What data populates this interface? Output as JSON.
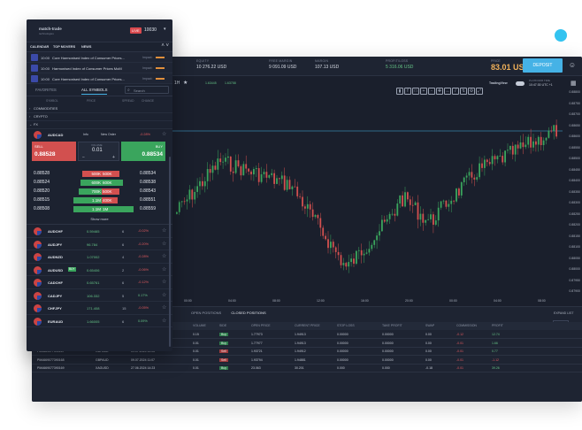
{
  "stats": [
    {
      "label": "EQUITY",
      "value": "10 276.22 USD"
    },
    {
      "label": "FREE MARGIN",
      "value": "9 091.09 USD"
    },
    {
      "label": "MARGIN",
      "value": "107.13 USD"
    },
    {
      "label": "PROFIT/LOSS",
      "value": "5 316.06 USD"
    }
  ],
  "price": {
    "label": "PRICE",
    "value": "83.01 USD"
  },
  "deposit_label": "DEPOSIT",
  "chart": {
    "timeframe": "1H",
    "bid_label": "1.63445",
    "ask_label": "1.63758",
    "logo_text": "TradingView",
    "platform_time_label": "PLATFORM TIME",
    "platform_time": "10:47:30 UTC +1",
    "price_ticks": [
      "0.88800",
      "0.88750",
      "0.88700",
      "0.88650",
      "0.88600",
      "0.88550",
      "0.88500",
      "0.88450",
      "0.88400",
      "0.88350",
      "0.88300",
      "0.88250",
      "0.88200",
      "0.88150",
      "0.88100",
      "0.88050",
      "0.88000",
      "0.87950",
      "0.87900"
    ],
    "time_ticks": [
      "00:00",
      "04:00",
      "08:00",
      "12:00",
      "16:00",
      "20:00",
      "00:00",
      "04:00",
      "08:00",
      "12:00",
      "16:00"
    ],
    "expand_label": "EXPAND LIST"
  },
  "positions": {
    "tabs": [
      "OPEN POSITIONS",
      "CLOSED POSITIONS"
    ],
    "reset_label": "RESET",
    "headers": [
      "ID",
      "SYMBOL",
      "OPEN TIME",
      "VOLUME",
      "SIDE",
      "OPEN PRICE",
      "CURRENT PRICE",
      "STOP LOSS",
      "TAKE PROFIT",
      "SWAP",
      "COMMISSION",
      "PROFIT"
    ],
    "rows": [
      {
        "id": "PM4669077390165",
        "symbol": "GBPAUD",
        "time": "09.07.2024 10:58",
        "volume": "0.15",
        "side": "Buy",
        "open": "1.77973",
        "current": "1.94913",
        "sl": "0.00000",
        "tp": "0.00000",
        "swap": "0.00",
        "comm": "-0.12",
        "profit": "12.74"
      },
      {
        "id": "PM4669077390166",
        "symbol": "GBPAUD",
        "time": "09.07.2024 11:02",
        "volume": "0.01",
        "side": "Buy",
        "open": "1.77977",
        "current": "1.94913",
        "sl": "0.00000",
        "tp": "0.00000",
        "swap": "0.00",
        "comm": "-0.01",
        "profit": "1.66"
      },
      {
        "id": "PM4669077390167",
        "symbol": "GBPAUD",
        "time": "09.07.2024 11:05",
        "volume": "0.01",
        "side": "Sell",
        "open": "1.93721",
        "current": "1.94912",
        "sl": "0.00000",
        "tp": "0.00000",
        "swap": "0.00",
        "comm": "-0.01",
        "profit": "0.77"
      },
      {
        "id": "PM4669077390168",
        "symbol": "GBPAUD",
        "time": "09.07.2024 11:07",
        "volume": "0.01",
        "side": "Sell",
        "open": "1.93794",
        "current": "1.94881",
        "sl": "0.00000",
        "tp": "0.00000",
        "swap": "0.00",
        "comm": "-0.01",
        "profit": "-1.12"
      },
      {
        "id": "PM4669077390169",
        "symbol": "XAGUSD",
        "time": "27.06.2024 14:23",
        "volume": "0.01",
        "side": "Buy",
        "open": "23.063",
        "current": "30.201",
        "sl": "0.000",
        "tp": "0.000",
        "swap": "-0.18",
        "comm": "-0.01",
        "profit": "39.26"
      }
    ]
  },
  "panel": {
    "logo": "match-trade",
    "logo_sub": "technologies",
    "live_tag": "LIVE",
    "balance": "10030",
    "tabs": [
      "CALENDAR",
      "TOP MOVERS",
      "NEWS"
    ],
    "arrows": "^ v",
    "news": [
      {
        "time": "10:00",
        "title": "Core Harmonised Index of Consumer Prices...",
        "impact": "Impact:"
      },
      {
        "time": "10:00",
        "title": "Harmonised Index of Consumer Prices MoM",
        "impact": "Impact:"
      },
      {
        "time": "10:00",
        "title": "Core Harmonised Index of Consumer Prices...",
        "impact": "Impact:"
      }
    ],
    "fav_tabs": [
      "FAVORITES",
      "ALL SYMBOLS"
    ],
    "search_placeholder": "Search",
    "col_heads": [
      "SYMBOL",
      "PRICE",
      "SPREAD",
      "CHANGE"
    ],
    "categories": [
      "COMMODITIES",
      "CRYPTO",
      "FX"
    ],
    "open_symbol": {
      "name": "AUDCAD",
      "info": "Info",
      "new_order": "New Order",
      "change": "-0.28%",
      "sell_label": "SELL",
      "sell_price": "0.88528",
      "buy_label": "BUY",
      "buy_price": "0.88534",
      "volume_label": "VOLUME",
      "volume": "0.01"
    },
    "book": [
      {
        "bid": "0.88528",
        "sell": "500K",
        "buy": "500K",
        "ask": "0.88534",
        "sell_green": false,
        "buy_green": false
      },
      {
        "bid": "0.88524",
        "sell": "600K",
        "buy": "600K",
        "ask": "0.88538",
        "sell_green": true,
        "buy_green": true
      },
      {
        "bid": "0.88520",
        "sell": "700K",
        "buy": "500K",
        "ask": "0.88543",
        "sell_green": true,
        "buy_green": false
      },
      {
        "bid": "0.88515",
        "sell": "1.1M",
        "buy": "400K",
        "ask": "0.88551",
        "sell_green": true,
        "buy_green": false
      },
      {
        "bid": "0.88508",
        "sell": "1.1M",
        "buy": "1M",
        "ask": "0.88559",
        "sell_green": true,
        "buy_green": true
      }
    ],
    "show_more": "Show more",
    "symbols": [
      {
        "name": "AUDCHF",
        "price": "0.59465",
        "spread": "6",
        "change": "-0.02%",
        "dir": "down",
        "badge": ""
      },
      {
        "name": "AUDJPY",
        "price": "96.784",
        "spread": "6",
        "change": "-0.20%",
        "dir": "down",
        "badge": ""
      },
      {
        "name": "AUDNZD",
        "price": "1.07002",
        "spread": "4",
        "change": "-0.28%",
        "dir": "down",
        "badge": ""
      },
      {
        "name": "AUDUSD",
        "price": "0.65406",
        "spread": "2",
        "change": "-0.06%",
        "dir": "down",
        "badge": "BUY"
      },
      {
        "name": "CADCHF",
        "price": "0.65761",
        "spread": "6",
        "change": "-0.12%",
        "dir": "down",
        "badge": ""
      },
      {
        "name": "CADJPY",
        "price": "106.332",
        "spread": "5",
        "change": "0.17%",
        "dir": "up",
        "badge": ""
      },
      {
        "name": "CHFJPY",
        "price": "171.408",
        "spread": "15",
        "change": "-0.05%",
        "dir": "down",
        "badge": ""
      },
      {
        "name": "EURAUD",
        "price": "1.66005",
        "spread": "6",
        "change": "0.09%",
        "dir": "up",
        "badge": ""
      }
    ]
  },
  "colors": {
    "accent": "#45b2e6",
    "buy": "#3aa55d",
    "sell": "#d2504f",
    "background": "#1a1f2c"
  }
}
